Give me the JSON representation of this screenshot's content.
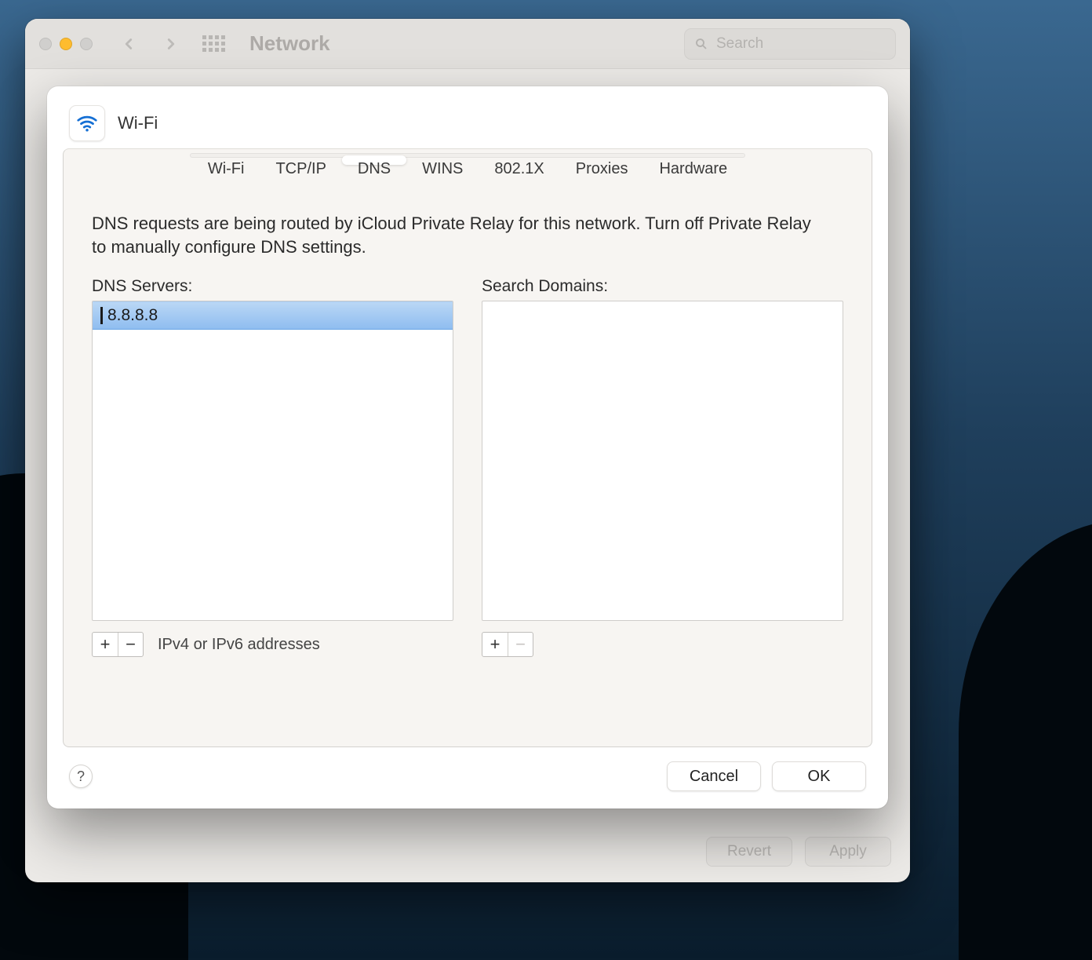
{
  "window": {
    "title": "Network",
    "search_placeholder": "Search",
    "footer": {
      "revert": "Revert",
      "apply": "Apply"
    }
  },
  "sheet": {
    "interface_name": "Wi-Fi",
    "tabs": [
      "Wi-Fi",
      "TCP/IP",
      "DNS",
      "WINS",
      "802.1X",
      "Proxies",
      "Hardware"
    ],
    "active_tab": "DNS",
    "info_text": "DNS requests are being routed by iCloud Private Relay for this network. Turn off Private Relay to manually configure DNS settings.",
    "dns": {
      "label": "DNS Servers:",
      "servers": [
        "8.8.8.8"
      ],
      "editing_index": 0,
      "hint": "IPv4 or IPv6 addresses"
    },
    "search_domains": {
      "label": "Search Domains:",
      "domains": []
    },
    "buttons": {
      "cancel": "Cancel",
      "ok": "OK",
      "help": "?"
    }
  }
}
